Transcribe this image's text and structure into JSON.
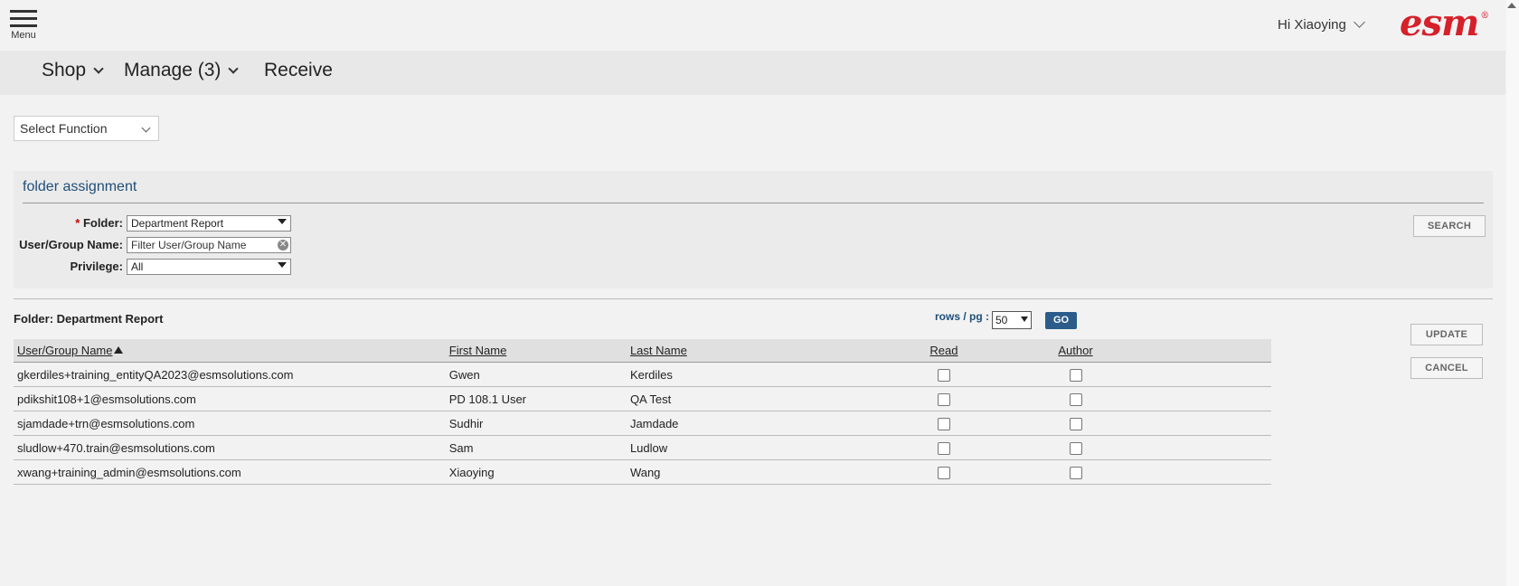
{
  "header": {
    "menu_label": "Menu",
    "greeting": "Hi Xiaoying",
    "logo_text": "esm",
    "logo_mark": "®"
  },
  "nav": {
    "shop": "Shop",
    "manage": "Manage (3)",
    "receive": "Receive"
  },
  "function_select": {
    "value": "Select Function"
  },
  "panel": {
    "title": "folder assignment",
    "folder_label": "Folder:",
    "folder_required": "*",
    "folder_value": "Department Report",
    "user_label": "User/Group Name:",
    "user_placeholder": "Filter User/Group Name",
    "privilege_label": "Privilege:",
    "privilege_value": "All",
    "search_button": "SEARCH"
  },
  "results": {
    "caption": "Folder: Department Report",
    "rows_label": "rows / pg :",
    "rows_value": "50",
    "go_button": "GO",
    "update_button": "UPDATE",
    "cancel_button": "CANCEL",
    "columns": {
      "user": "User/Group Name",
      "first": "First Name",
      "last": "Last Name",
      "read": "Read",
      "author": "Author"
    },
    "rows": [
      {
        "user": "gkerdiles+training_entityQA2023@esmsolutions.com",
        "first": "Gwen",
        "last": "Kerdiles",
        "read": false,
        "author": false
      },
      {
        "user": "pdikshit108+1@esmsolutions.com",
        "first": "PD 108.1 User",
        "last": "QA Test",
        "read": false,
        "author": false
      },
      {
        "user": "sjamdade+trn@esmsolutions.com",
        "first": "Sudhir",
        "last": "Jamdade",
        "read": false,
        "author": false
      },
      {
        "user": "sludlow+470.train@esmsolutions.com",
        "first": "Sam",
        "last": "Ludlow",
        "read": false,
        "author": false
      },
      {
        "user": "xwang+training_admin@esmsolutions.com",
        "first": "Xiaoying",
        "last": "Wang",
        "read": false,
        "author": false
      }
    ]
  }
}
